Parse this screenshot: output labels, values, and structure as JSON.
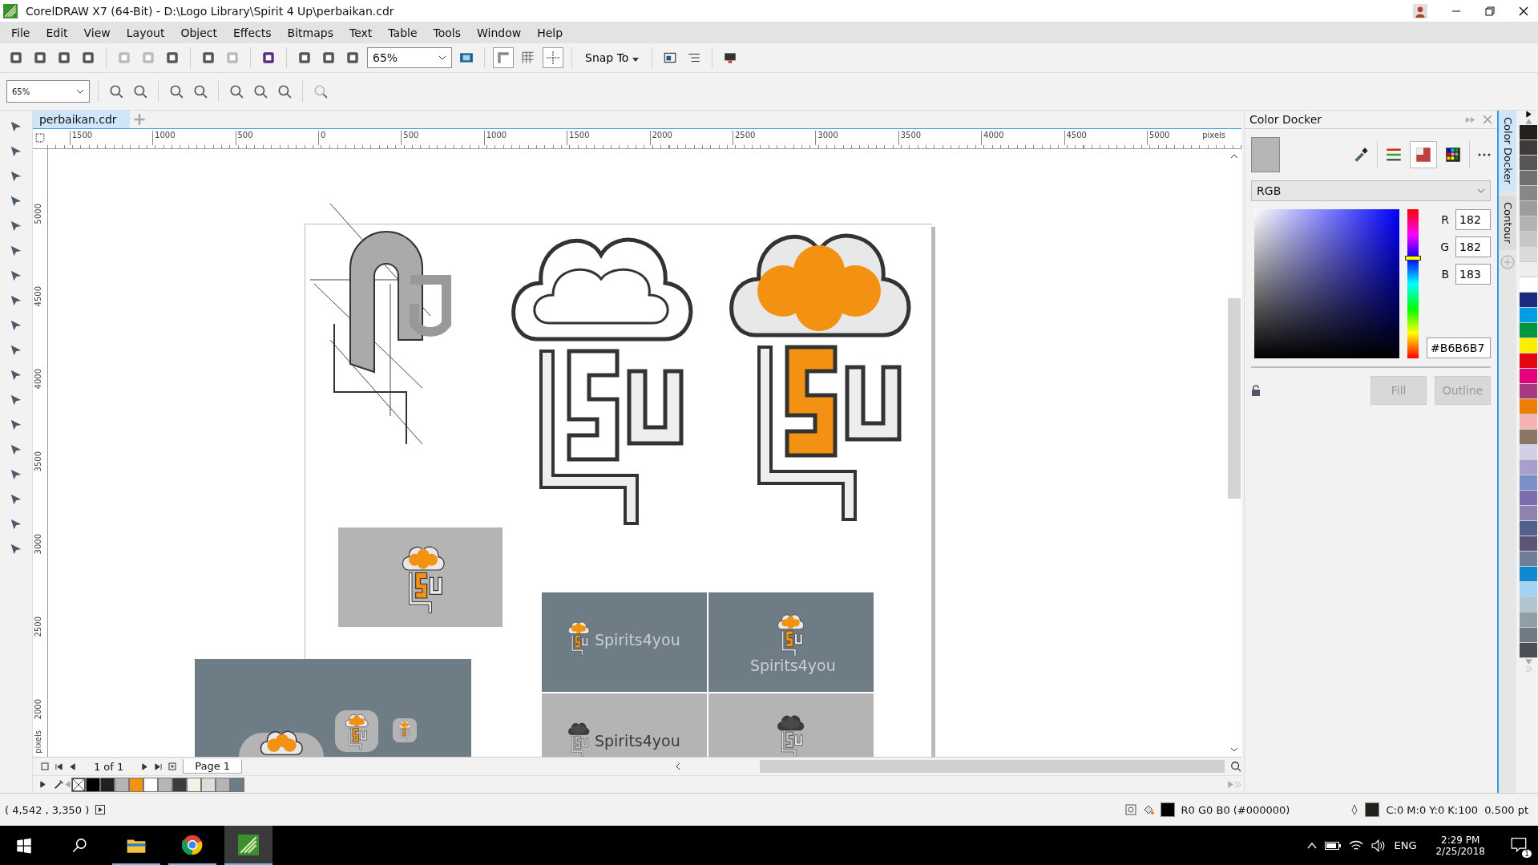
{
  "window": {
    "title": "CorelDRAW X7 (64-Bit) - D:\\Logo Library\\Spirit 4 Up\\perbaikan.cdr"
  },
  "menu": [
    "File",
    "Edit",
    "View",
    "Layout",
    "Object",
    "Effects",
    "Bitmaps",
    "Text",
    "Table",
    "Tools",
    "Window",
    "Help"
  ],
  "standard_toolbar": {
    "zoom": "65%",
    "snap": "Snap To"
  },
  "zoom_toolbar": {
    "zoom": "65%"
  },
  "tabs": [
    {
      "label": "perbaikan.cdr",
      "selected": true
    }
  ],
  "ruler_h": [
    "1500",
    "1000",
    "500",
    "0",
    "500",
    "1000",
    "1500",
    "2000",
    "2500",
    "3000",
    "3500",
    "4000",
    "4500",
    "5000"
  ],
  "ruler_h_unit": "pixels",
  "ruler_v": [
    "5000",
    "4500",
    "4000",
    "3500",
    "3000",
    "2500",
    "2000"
  ],
  "ruler_v_unit": "pixels",
  "canvas": {
    "panels": [
      {
        "kind": "dark",
        "text": "Spirits4you",
        "stacked": false
      },
      {
        "kind": "dark",
        "text": "Spirits4you",
        "stacked": true
      },
      {
        "kind": "light",
        "text": "Spirits4you",
        "stacked": false
      },
      {
        "kind": "light",
        "stacked": true
      }
    ]
  },
  "page_nav": {
    "count": "1 of 1",
    "pages": [
      {
        "label": "Page 1",
        "selected": true
      }
    ]
  },
  "document_palette": [
    {
      "color": "#000000"
    },
    {
      "color": "#231f1c"
    },
    {
      "color": "#b4b4b4"
    },
    {
      "color": "#f39212"
    },
    {
      "color": "#ffffff"
    },
    {
      "color": "#b6b6b7"
    },
    {
      "color": "#3c3c3c"
    },
    {
      "color": "#f5f0e6"
    },
    {
      "color": "#dcdcdc"
    },
    {
      "color": "#b4b4b4"
    },
    {
      "color": "#6e7c86"
    }
  ],
  "color_docker": {
    "title": "Color Docker",
    "model": "RGB",
    "hue_slider": {
      "level": 0.67
    },
    "channels": [
      {
        "label": "R",
        "value": "182"
      },
      {
        "label": "G",
        "value": "182"
      },
      {
        "label": "B",
        "value": "183"
      }
    ],
    "hex": "#B6B6B7",
    "buttons": [
      {
        "label": "Fill",
        "disabled": true
      },
      {
        "label": "Outline",
        "disabled": true
      }
    ]
  },
  "docker_tabs": [
    {
      "label": "Color Docker",
      "selected": true
    },
    {
      "label": "Contour",
      "selected": false
    }
  ],
  "palette": [
    {
      "color": "#231f1c"
    },
    {
      "color": "#3d3a39"
    },
    {
      "color": "#575656"
    },
    {
      "color": "#707070"
    },
    {
      "color": "#878787"
    },
    {
      "color": "#9d9d9c"
    },
    {
      "color": "#b2b2b2"
    },
    {
      "color": "#c6c6c6"
    },
    {
      "color": "#dadada"
    },
    {
      "color": "#ededed"
    },
    {
      "color": "#ffffff"
    },
    {
      "color": "#1d2a82"
    },
    {
      "color": "#009fe3"
    },
    {
      "color": "#009640"
    },
    {
      "color": "#ffed00"
    },
    {
      "color": "#e30613"
    },
    {
      "color": "#e6007e"
    },
    {
      "color": "#a73b7f"
    },
    {
      "color": "#ef7d00"
    },
    {
      "color": "#f5b3b4"
    },
    {
      "color": "#8a7566"
    },
    {
      "color": "#d3cfe6"
    },
    {
      "color": "#a99fcf"
    },
    {
      "color": "#7a8fc7"
    },
    {
      "color": "#7d6db0"
    },
    {
      "color": "#8e83b0"
    },
    {
      "color": "#52618c"
    },
    {
      "color": "#5c5577"
    },
    {
      "color": "#6f7f99"
    },
    {
      "color": "#0e88d3"
    },
    {
      "color": "#a3d3f0"
    },
    {
      "color": "#b2c4d0"
    },
    {
      "color": "#909ea7"
    },
    {
      "color": "#6e7a84"
    },
    {
      "color": "#4b4f55"
    }
  ],
  "status_bar": {
    "coordinates": "( 4,542 , 3,350 )",
    "fill": "R0 G0 B0 (#000000)",
    "fill_swatch": {
      "color": "#000000"
    },
    "outline": "C:0 M:0 Y:0 K:100  0.500 pt",
    "outline_swatch": {
      "color": "#231f1c"
    }
  },
  "taskbar": {
    "language": "ENG",
    "time": "2:29 PM",
    "date": "2/25/2018",
    "notifications": "1"
  }
}
